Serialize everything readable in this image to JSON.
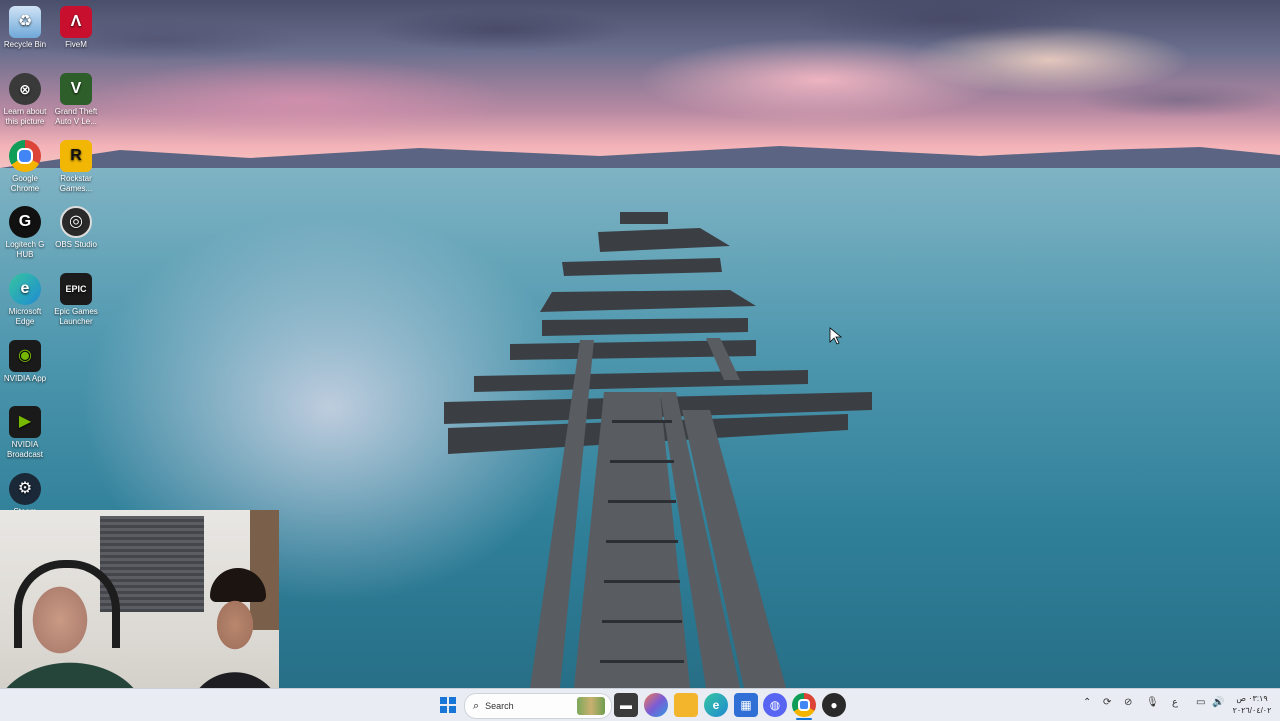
{
  "desktop": {
    "icons": [
      {
        "label": "Recycle Bin",
        "icon": "recycle-bin-icon",
        "color": "#6fa8d8"
      },
      {
        "label": "FiveM",
        "icon": "fivem-icon",
        "color": "#c8102e"
      },
      {
        "label": "Learn about this picture",
        "icon": "learn-about-icon",
        "color": "#3a3a3a"
      },
      {
        "label": "Grand Theft Auto V Le...",
        "icon": "gta-v-icon",
        "color": "#2e5e2a"
      },
      {
        "label": "Google Chrome",
        "icon": "chrome-icon",
        "color": "#db4437"
      },
      {
        "label": "Rockstar Games...",
        "icon": "rockstar-icon",
        "color": "#f2b705"
      },
      {
        "label": "Logitech G HUB",
        "icon": "logitech-g-hub-icon",
        "color": "#111111"
      },
      {
        "label": "OBS Studio",
        "icon": "obs-studio-icon",
        "color": "#2a2a2a"
      },
      {
        "label": "Microsoft Edge",
        "icon": "edge-icon",
        "color": "#1f8ad2"
      },
      {
        "label": "Epic Games Launcher",
        "icon": "epic-games-icon",
        "color": "#1b1b1b"
      },
      {
        "label": "NVIDIA App",
        "icon": "nvidia-app-icon",
        "color": "#76b900"
      },
      {
        "label": "NVIDIA Broadcast",
        "icon": "nvidia-broadcast-icon",
        "color": "#4d7f13"
      },
      {
        "label": "Steam",
        "icon": "steam-icon",
        "color": "#1b2838"
      }
    ]
  },
  "taskbar": {
    "search_placeholder": "Search",
    "pinned": [
      {
        "name": "start-button",
        "glyph": "■",
        "color": "#1877d6"
      },
      {
        "name": "file-explorer-taskbar-icon",
        "glyph": "▬",
        "color": "#333333"
      },
      {
        "name": "copilot-taskbar-icon",
        "glyph": "◉",
        "color": "#7b5cd6"
      },
      {
        "name": "folder-taskbar-icon",
        "glyph": "▰",
        "color": "#f2b52b"
      },
      {
        "name": "edge-taskbar-icon",
        "glyph": "◐",
        "color": "#1f8ad2"
      },
      {
        "name": "store-taskbar-icon",
        "glyph": "▦",
        "color": "#2f6fd6"
      },
      {
        "name": "discord-taskbar-icon",
        "glyph": "◍",
        "color": "#5865f2"
      },
      {
        "name": "chrome-taskbar-icon",
        "glyph": "◎",
        "color": "#db4437"
      },
      {
        "name": "obs-taskbar-icon",
        "glyph": "●",
        "color": "#2a2a2a"
      }
    ],
    "tray": {
      "language": "ع",
      "time": "٠٣:١٩ ص",
      "date": "٢٠٢٦/٠٤/٠٢"
    }
  }
}
